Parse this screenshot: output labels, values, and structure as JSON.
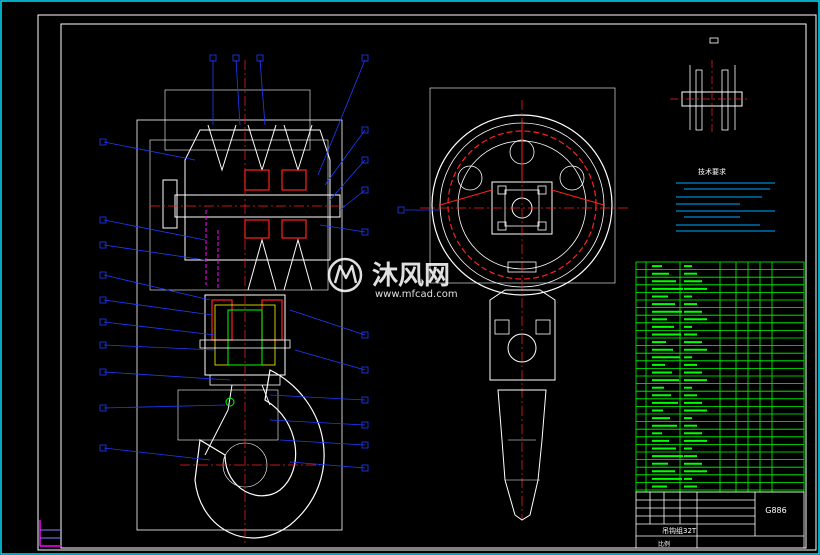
{
  "drawing": {
    "tech_title": "技术要求",
    "drawing_code": "G886",
    "part_name": "吊钩组32T",
    "scale_label": "比例"
  },
  "watermark": {
    "brand": "沐风网",
    "url": "www.mfcad.com"
  },
  "colors": {
    "background": "#000000",
    "outline": "#ffffff",
    "frame": "#00ff00",
    "leader": "#1e3cff",
    "center": "#ff2020",
    "hidden": "#ffff00",
    "section": "#ff00ff",
    "cyan": "#00e0ff"
  }
}
